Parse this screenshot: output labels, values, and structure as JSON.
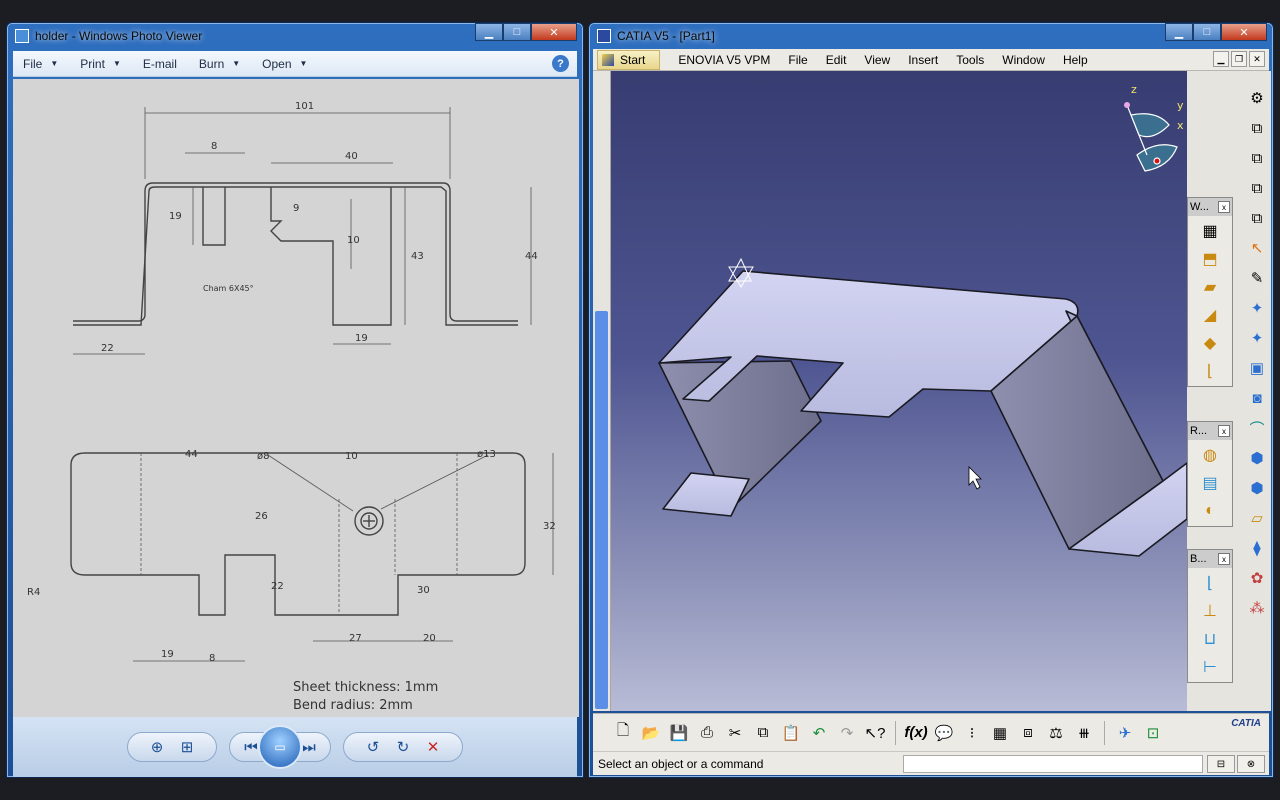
{
  "photo_viewer": {
    "title": "holder - Windows Photo Viewer",
    "menu": [
      {
        "label": "File",
        "has_arrow": true
      },
      {
        "label": "Print",
        "has_arrow": true
      },
      {
        "label": "E-mail",
        "has_arrow": false
      },
      {
        "label": "Burn",
        "has_arrow": true
      },
      {
        "label": "Open",
        "has_arrow": true
      }
    ],
    "drawing": {
      "front_view": {
        "overall": "101",
        "slot_width": "8",
        "cut_width": "40",
        "slot_depth": "19",
        "notch": "9",
        "drop": "10",
        "chamfer": "Cham 6X45°",
        "height_inner": "43",
        "height_outer": "44",
        "flange": "22",
        "bottom_width": "19"
      },
      "top_view": {
        "dim_44": "44",
        "hole_small": "ø8",
        "dim_10": "10",
        "hole_large": "ø13",
        "dim_26": "26",
        "dim_32": "32",
        "radius": "R4",
        "dim_22": "22",
        "dim_30": "30",
        "dim_19": "19",
        "dim_8": "8",
        "dim_27": "27",
        "dim_20": "20"
      },
      "note_thickness": "Sheet thickness: 1mm",
      "note_bend": "Bend radius: 2mm"
    }
  },
  "catia": {
    "title": "CATIA V5 - [Part1]",
    "menu": [
      "Start",
      "ENOVIA V5 VPM",
      "File",
      "Edit",
      "View",
      "Insert",
      "Tools",
      "Window",
      "Help"
    ],
    "compass_axes": {
      "z": "z",
      "y": "y",
      "x": "x"
    },
    "toolbars": [
      {
        "title": "W...",
        "close": "x"
      },
      {
        "title": "R...",
        "close": "x"
      },
      {
        "title": "B...",
        "close": "x"
      }
    ],
    "logo": "CATIA",
    "status": "Select an object or a command",
    "function_label": "f(x)"
  },
  "colors": {
    "viewport_top": "#373d71",
    "viewport_bottom": "#b9bcd6",
    "part_face": "#c9cbef",
    "window_frame": "#2f6fbf"
  }
}
